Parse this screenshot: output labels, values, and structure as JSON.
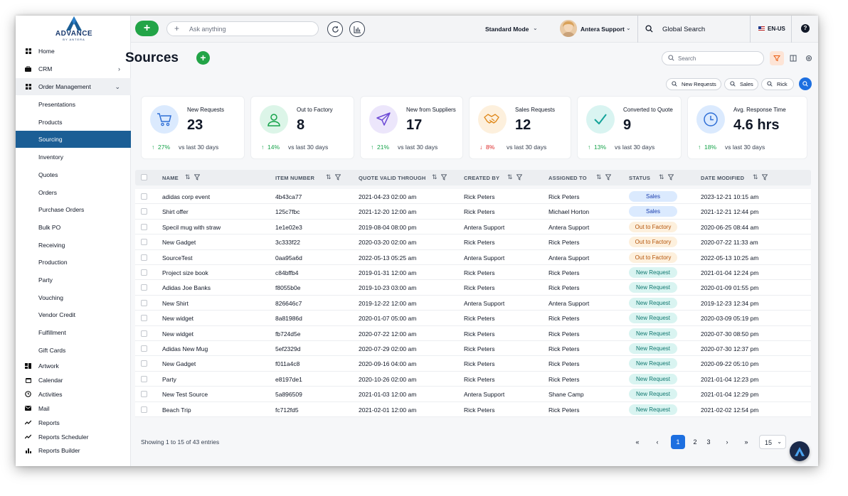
{
  "brand": {
    "name": "ADVANCE",
    "tagline": "BY ANTERA"
  },
  "sidebar": {
    "items": [
      {
        "label": "Home",
        "icon": "grid-icon"
      },
      {
        "label": "CRM",
        "icon": "briefcase-icon",
        "chevron": "›"
      },
      {
        "label": "Order Management",
        "icon": "grid-icon",
        "chevron": "⌄"
      }
    ],
    "sub_items": [
      "Presentations",
      "Products",
      "Sourcing",
      "Inventory",
      "Quotes",
      "Orders",
      "Purchase Orders",
      "Bulk PO",
      "Receiving",
      "Production",
      "Party",
      "Vouching",
      "Vendor Credit",
      "Fulfillment",
      "Gift Cards"
    ],
    "bottom_items": [
      {
        "label": "Artwork",
        "icon": "artwork-icon"
      },
      {
        "label": "Calendar",
        "icon": "calendar-icon"
      },
      {
        "label": "Activities",
        "icon": "clock-icon"
      },
      {
        "label": "Mail",
        "icon": "mail-icon"
      },
      {
        "label": "Reports",
        "icon": "trend-icon"
      },
      {
        "label": "Reports Scheduler",
        "icon": "trend-icon"
      },
      {
        "label": "Reports Builder",
        "icon": "bar-chart-icon"
      }
    ]
  },
  "topbar": {
    "ask_placeholder": "Ask anything",
    "mode": "Standard Mode",
    "user": "Antera Support",
    "global_search": "Global Search",
    "language": "EN-US"
  },
  "page": {
    "title": "Sources",
    "search_placeholder": "Search",
    "chips": [
      "New Requests",
      "Sales",
      "Rick"
    ]
  },
  "stats": [
    {
      "label": "New Requests",
      "value": "23",
      "delta": "27%",
      "direction": "up",
      "compare": "vs last 30 days",
      "icon": "cart-icon",
      "color": "#dbeafe"
    },
    {
      "label": "Out to Factory",
      "value": "8",
      "delta": "14%",
      "direction": "up",
      "compare": "vs last 30 days",
      "icon": "person-icon",
      "color": "#dcf5e8"
    },
    {
      "label": "New from Suppliers",
      "value": "17",
      "delta": "21%",
      "direction": "up",
      "compare": "vs last 30 days",
      "icon": "paper-plane-icon",
      "color": "#ece6fb"
    },
    {
      "label": "Sales Requests",
      "value": "12",
      "delta": "8%",
      "direction": "down",
      "compare": "vs last 30 days",
      "icon": "handshake-icon",
      "color": "#fdf0dd"
    },
    {
      "label": "Converted to Quote",
      "value": "9",
      "delta": "13%",
      "direction": "up",
      "compare": "vs last 30 days",
      "icon": "check-icon",
      "color": "#d9f4f1"
    },
    {
      "label": "Avg. Response Time",
      "value": "4.6 hrs",
      "delta": "18%",
      "direction": "up",
      "compare": "vs last 30 days",
      "icon": "clock-icon",
      "color": "#dbeafe"
    }
  ],
  "table": {
    "columns": [
      "NAME",
      "ITEM NUMBER",
      "QUOTE VALID THROUGH",
      "CREATED BY",
      "ASSIGNED TO",
      "STATUS",
      "DATE MODIFIED"
    ],
    "rows": [
      [
        "adidas corp event",
        "4b43ca77",
        "2021-04-23 02:00 am",
        "Rick Peters",
        "Rick Peters",
        "Sales",
        "2023-12-21 10:15 am"
      ],
      [
        "Shirt offer",
        "125c7fbc",
        "2021-12-20 12:00 am",
        "Rick Peters",
        "Michael Horton",
        "Sales",
        "2021-12-21 12:44 pm"
      ],
      [
        "Specil mug with straw",
        "1e1e02e3",
        "2019-08-04 08:00 pm",
        "Antera Support",
        "Antera Support",
        "Out to Factory",
        "2020-06-25 08:44 am"
      ],
      [
        "New Gadget",
        "3c333f22",
        "2020-03-20 02:00 am",
        "Rick Peters",
        "Rick Peters",
        "Out to Factory",
        "2020-07-22 11:33 am"
      ],
      [
        "SourceTest",
        "0aa95a6d",
        "2022-05-13 05:25 am",
        "Antera Support",
        "Antera Support",
        "Out to Factory",
        "2022-05-13 10:25 am"
      ],
      [
        "Project size book",
        "c84bffb4",
        "2019-01-31 12:00 am",
        "Rick Peters",
        "Rick Peters",
        "New Request",
        "2021-01-04 12:24 pm"
      ],
      [
        "Adidas Joe Banks",
        "f8055b0e",
        "2019-10-23 03:00 am",
        "Rick Peters",
        "Rick Peters",
        "New Request",
        "2020-01-09 01:55 pm"
      ],
      [
        "New Shirt",
        "826646c7",
        "2019-12-22 12:00 am",
        "Antera Support",
        "Antera Support",
        "New Request",
        "2019-12-23 12:34 pm"
      ],
      [
        "New widget",
        "8a81986d",
        "2020-01-07 05:00 am",
        "Rick Peters",
        "Rick Peters",
        "New Request",
        "2020-03-09 05:19 pm"
      ],
      [
        "New widget",
        "fb724d5e",
        "2020-07-22 12:00 am",
        "Rick Peters",
        "Rick Peters",
        "New Request",
        "2020-07-30 08:50 pm"
      ],
      [
        "Adidas New Mug",
        "5ef2329d",
        "2020-07-29 02:00 am",
        "Rick Peters",
        "Rick Peters",
        "New Request",
        "2020-07-30 12:37 pm"
      ],
      [
        "New Gadget",
        "f011a4c8",
        "2020-09-16 04:00 am",
        "Rick Peters",
        "Rick Peters",
        "New Request",
        "2020-09-22 05:10 pm"
      ],
      [
        "Party",
        "e8197de1",
        "2020-10-26 02:00 am",
        "Rick Peters",
        "Rick Peters",
        "New Request",
        "2021-01-04 12:23 pm"
      ],
      [
        "New Test Source",
        "5a896509",
        "2021-01-03 12:00 am",
        "Antera Support",
        "Shane Camp",
        "New Request",
        "2021-01-04 12:29 pm"
      ],
      [
        "Beach Trip",
        "fc712fd5",
        "2021-02-01 12:00 am",
        "Rick Peters",
        "Rick Peters",
        "New Request",
        "2021-02-02 12:54 pm"
      ]
    ]
  },
  "pagination": {
    "summary": "Showing 1 to 15 of 43 entries",
    "first": "«",
    "prev": "‹",
    "next": "›",
    "last": "»",
    "pages": [
      "1",
      "2",
      "3"
    ],
    "current": "1",
    "page_size": "15"
  }
}
